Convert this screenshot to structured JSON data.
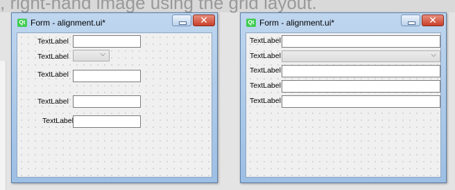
{
  "page": {
    "background_text": ", right-hand image using the grid layout."
  },
  "left_window": {
    "title": "Form - alignment.ui*",
    "app_icon_text": "Qt",
    "labels": [
      "TextLabel",
      "TextLabel",
      "TextLabel",
      "TextLabel",
      "TextLabel"
    ],
    "combo_selected": ""
  },
  "right_window": {
    "title": "Form - alignment.ui*",
    "app_icon_text": "Qt",
    "labels": [
      "TextLabel",
      "TextLabel",
      "TextLabel",
      "TextLabel",
      "TextLabel"
    ],
    "combo_selected": ""
  },
  "icons": {
    "minimize": "minimize-icon",
    "close": "close-icon",
    "dropdown": "chevron-down-icon",
    "app": "qt-logo-icon"
  },
  "colors": {
    "close_button": "#c8402b",
    "titlebar": "#bfd6ef",
    "qt_green": "#41cd52"
  }
}
